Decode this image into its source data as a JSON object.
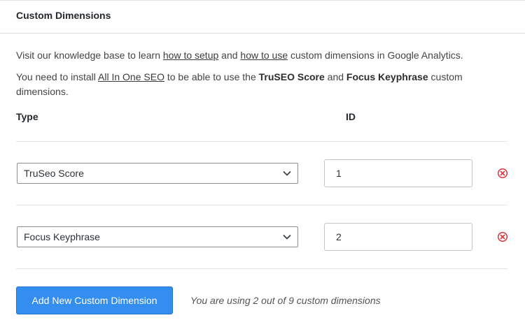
{
  "panel": {
    "title": "Custom Dimensions"
  },
  "intro": {
    "line1_pre": "Visit our knowledge base to learn ",
    "link_setup": "how to setup",
    "line1_mid": " and ",
    "link_use": "how to use",
    "line1_post": " custom dimensions in Google Analytics.",
    "line2_pre": "You need to install ",
    "link_aioseo": "All In One SEO",
    "line2_mid": " to be able to use the ",
    "bold1": "TruSEO Score",
    "line2_and": " and ",
    "bold2": "Focus Keyphrase",
    "line2_post": " custom dimensions."
  },
  "table": {
    "col_type": "Type",
    "col_id": "ID",
    "rows": [
      {
        "type": "TruSeo Score",
        "id": "1"
      },
      {
        "type": "Focus Keyphrase",
        "id": "2"
      }
    ]
  },
  "footer": {
    "add_button": "Add New Custom Dimension",
    "usage_text": "You are using 2 out of 9 custom dimensions"
  },
  "colors": {
    "button_bg": "#338eef",
    "remove_icon": "#d63638",
    "divider": "#e4e4e4"
  },
  "icons": {
    "select_arrow": "chevron-down-icon",
    "remove": "remove-circle-x-icon"
  }
}
